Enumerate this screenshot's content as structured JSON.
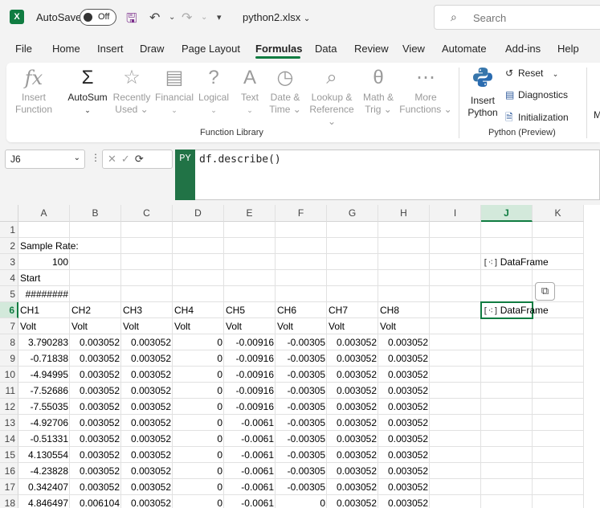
{
  "titlebar": {
    "app_icon": "X",
    "autosave_label": "AutoSave",
    "autosave_state": "Off",
    "filename": "python2.xlsx",
    "search_placeholder": "Search"
  },
  "menu": [
    "File",
    "Home",
    "Insert",
    "Draw",
    "Page Layout",
    "Formulas",
    "Data",
    "Review",
    "View",
    "Automate",
    "Add-ins",
    "Help"
  ],
  "menu_active": "Formulas",
  "ribbon": {
    "function_library": {
      "label": "Function Library",
      "buttons": [
        {
          "line1": "Insert",
          "line2": "Function",
          "icon": "fx",
          "enabled": false
        },
        {
          "line1": "AutoSum",
          "line2": "⌄",
          "icon": "Σ",
          "enabled": true
        },
        {
          "line1": "Recently",
          "line2": "Used ⌄",
          "icon": "☆",
          "enabled": false
        },
        {
          "line1": "Financial",
          "line2": "⌄",
          "icon": "▤",
          "enabled": false
        },
        {
          "line1": "Logical",
          "line2": "⌄",
          "icon": "?",
          "enabled": false
        },
        {
          "line1": "Text",
          "line2": "⌄",
          "icon": "A",
          "enabled": false
        },
        {
          "line1": "Date &",
          "line2": "Time ⌄",
          "icon": "◷",
          "enabled": false
        },
        {
          "line1": "Lookup &",
          "line2": "Reference ⌄",
          "icon": "⌕",
          "enabled": false
        },
        {
          "line1": "Math &",
          "line2": "Trig ⌄",
          "icon": "θ",
          "enabled": false
        },
        {
          "line1": "More",
          "line2": "Functions ⌄",
          "icon": "⋯",
          "enabled": false
        }
      ]
    },
    "python": {
      "label": "Python (Preview)",
      "insert_line1": "Insert",
      "insert_line2": "Python",
      "reset": "Reset",
      "diagnostics": "Diagnostics",
      "initialization": "Initialization"
    },
    "overflow": "M"
  },
  "formula_bar": {
    "name_box": "J6",
    "badge": "PY",
    "formula": "df.describe()"
  },
  "columns": [
    "A",
    "B",
    "C",
    "D",
    "E",
    "F",
    "G",
    "H",
    "I",
    "J",
    "K"
  ],
  "rows": [
    "1",
    "2",
    "3",
    "4",
    "5",
    "6",
    "7",
    "8",
    "9",
    "10",
    "11",
    "12",
    "13",
    "14",
    "15",
    "16",
    "17",
    "18"
  ],
  "cells": {
    "r2": [
      "Sample Rate:"
    ],
    "r3": [
      "100"
    ],
    "r4": [
      "Start"
    ],
    "r5": [
      "########"
    ],
    "r6": [
      "CH1",
      "CH2",
      "CH3",
      "CH4",
      "CH5",
      "CH6",
      "CH7",
      "CH8"
    ],
    "r7": [
      "Volt",
      "Volt",
      "Volt",
      "Volt",
      "Volt",
      "Volt",
      "Volt",
      "Volt"
    ],
    "data": [
      [
        "3.790283",
        "0.003052",
        "0.003052",
        "0",
        "-0.00916",
        "-0.00305",
        "0.003052",
        "0.003052"
      ],
      [
        "-0.71838",
        "0.003052",
        "0.003052",
        "0",
        "-0.00916",
        "-0.00305",
        "0.003052",
        "0.003052"
      ],
      [
        "-4.94995",
        "0.003052",
        "0.003052",
        "0",
        "-0.00916",
        "-0.00305",
        "0.003052",
        "0.003052"
      ],
      [
        "-7.52686",
        "0.003052",
        "0.003052",
        "0",
        "-0.00916",
        "-0.00305",
        "0.003052",
        "0.003052"
      ],
      [
        "-7.55035",
        "0.003052",
        "0.003052",
        "0",
        "-0.00916",
        "-0.00305",
        "0.003052",
        "0.003052"
      ],
      [
        "-4.92706",
        "0.003052",
        "0.003052",
        "0",
        "-0.0061",
        "-0.00305",
        "0.003052",
        "0.003052"
      ],
      [
        "-0.51331",
        "0.003052",
        "0.003052",
        "0",
        "-0.0061",
        "-0.00305",
        "0.003052",
        "0.003052"
      ],
      [
        "4.130554",
        "0.003052",
        "0.003052",
        "0",
        "-0.0061",
        "-0.00305",
        "0.003052",
        "0.003052"
      ],
      [
        "-4.23828",
        "0.003052",
        "0.003052",
        "0",
        "-0.0061",
        "-0.00305",
        "0.003052",
        "0.003052"
      ],
      [
        "0.342407",
        "0.003052",
        "0.003052",
        "0",
        "-0.0061",
        "-0.00305",
        "0.003052",
        "0.003052"
      ],
      [
        "4.846497",
        "0.006104",
        "0.003052",
        "0",
        "-0.0061",
        "0",
        "0.003052",
        "0.003052"
      ]
    ],
    "j3": "DataFrame",
    "j6": "DataFrame",
    "df_chip": "[⁖]"
  }
}
